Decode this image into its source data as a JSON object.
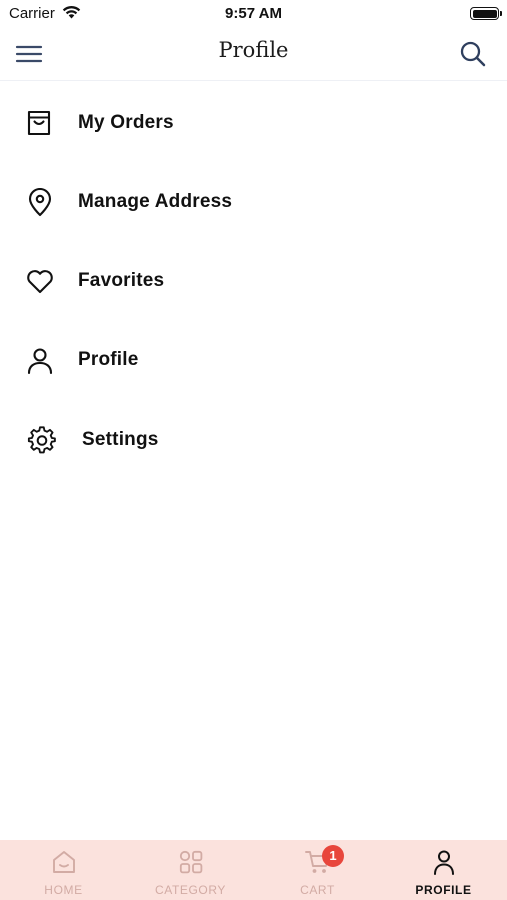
{
  "status_bar": {
    "carrier": "Carrier",
    "time": "9:57 AM"
  },
  "header": {
    "title": "Profile",
    "menu_icon": "hamburger-menu-icon",
    "search_icon": "search-icon"
  },
  "menu": {
    "items": [
      {
        "label": "My Orders",
        "icon": "shopping-bag-icon"
      },
      {
        "label": "Manage Address",
        "icon": "location-pin-icon"
      },
      {
        "label": "Favorites",
        "icon": "heart-icon"
      },
      {
        "label": "Profile",
        "icon": "person-icon"
      },
      {
        "label": "Settings",
        "icon": "gear-icon"
      }
    ]
  },
  "tab_bar": {
    "tabs": [
      {
        "label": "HOME",
        "icon": "home-icon",
        "active": false
      },
      {
        "label": "CATEGORY",
        "icon": "grid-icon",
        "active": false
      },
      {
        "label": "CART",
        "icon": "cart-icon",
        "active": false
      },
      {
        "label": "PROFILE",
        "icon": "person-icon",
        "active": true
      }
    ],
    "cart_badge": "1"
  },
  "colors": {
    "tab_bar_bg": "#fbe2dd",
    "tab_inactive": "#d2aba4",
    "badge": "#e8463c",
    "text": "#111111"
  }
}
